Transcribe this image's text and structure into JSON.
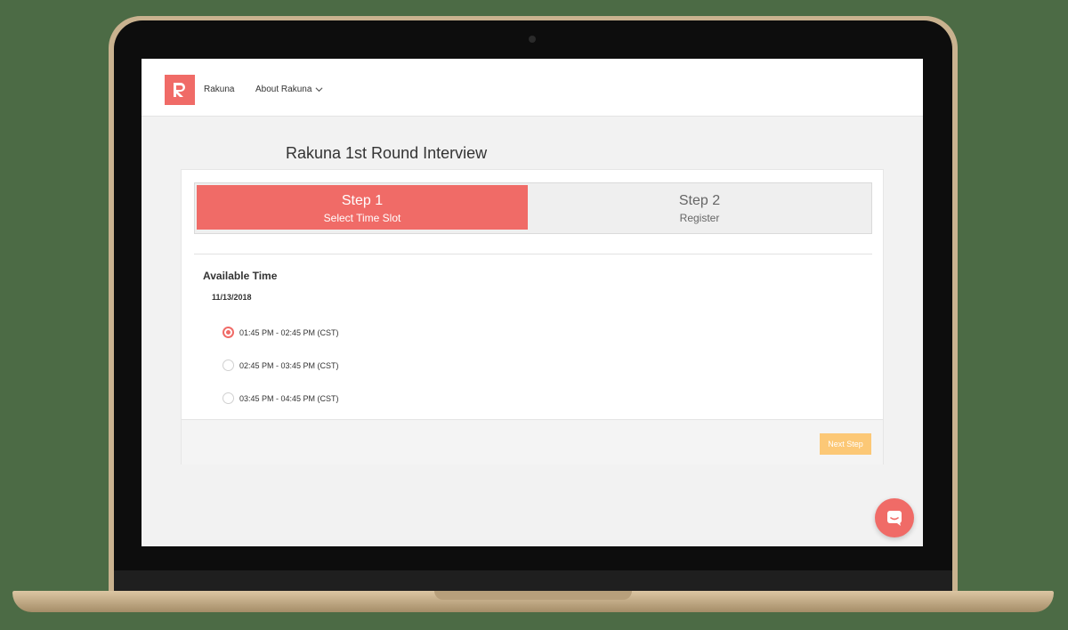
{
  "nav": {
    "brand": "Rakuna",
    "about": "About Rakuna"
  },
  "page": {
    "title": "Rakuna 1st Round Interview"
  },
  "steps": [
    {
      "title": "Step 1",
      "subtitle": "Select Time Slot",
      "active": true
    },
    {
      "title": "Step 2",
      "subtitle": "Register",
      "active": false
    }
  ],
  "available": {
    "title": "Available Time",
    "date": "11/13/2018",
    "slots": [
      {
        "label": "01:45 PM - 02:45 PM (CST)",
        "selected": true
      },
      {
        "label": "02:45 PM - 03:45 PM (CST)",
        "selected": false
      },
      {
        "label": "03:45 PM - 04:45 PM (CST)",
        "selected": false
      }
    ]
  },
  "footer": {
    "next_label": "Next Step"
  },
  "icons": {
    "logo": "rakuna-logo-icon",
    "nav_chevron": "chevron-down-icon",
    "chat": "chat-icon"
  },
  "colors": {
    "brand": "#f06b67",
    "next_button": "#fcc876"
  }
}
